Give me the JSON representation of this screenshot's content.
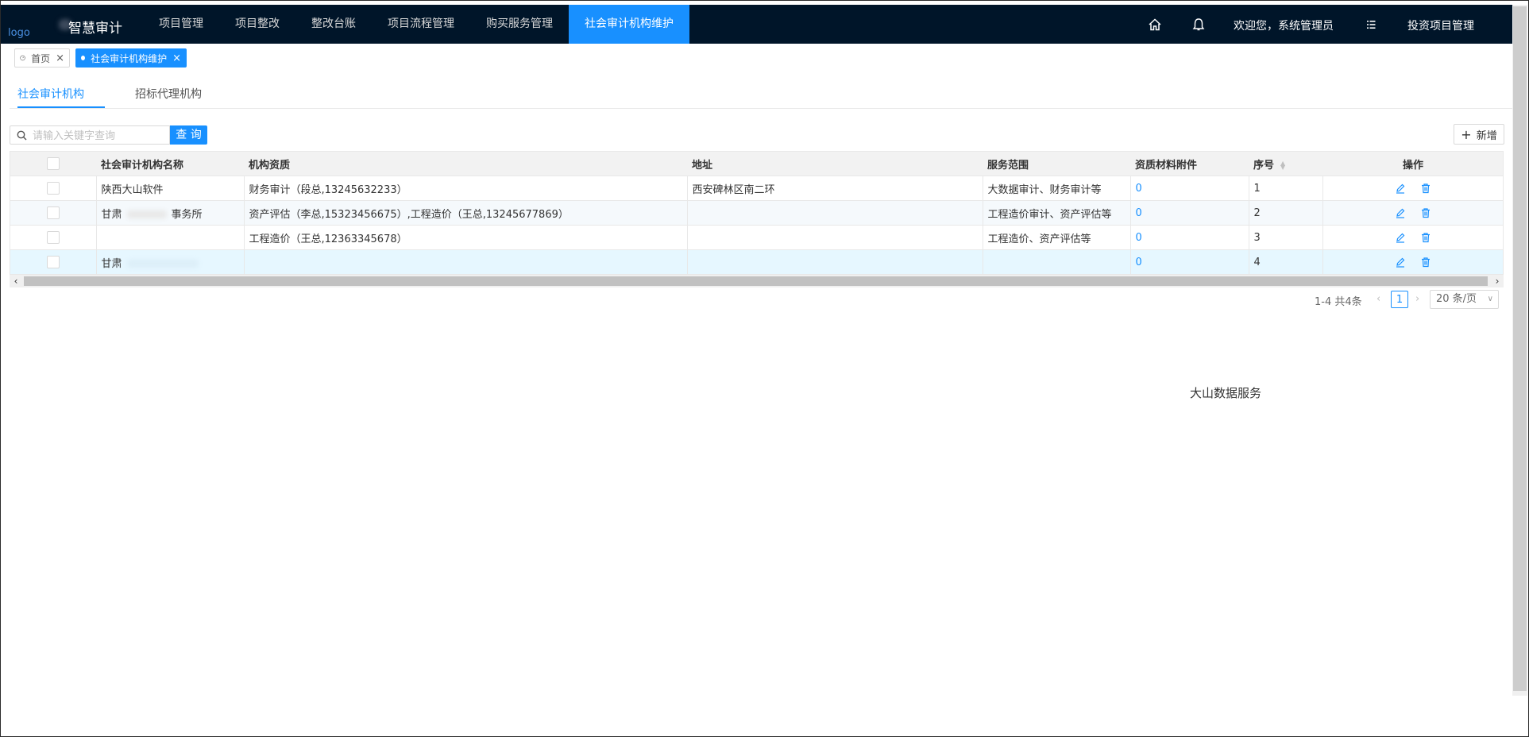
{
  "header": {
    "logo": "logo",
    "brand": "智慧审计",
    "nav": [
      "项目管理",
      "项目整改",
      "整改台账",
      "项目流程管理",
      "购买服务管理",
      "社会审计机构维护"
    ],
    "active_nav": "社会审计机构维护",
    "welcome": "欢迎您，系统管理员",
    "project_switch": "投资项目管理",
    "icons": [
      "home-icon",
      "bell-icon",
      "list-icon"
    ]
  },
  "tags": {
    "home": "首页",
    "current": "社会审计机构维护"
  },
  "subtabs": [
    "社会审计机构",
    "招标代理机构"
  ],
  "search": {
    "placeholder": "请输入关键字查询",
    "button": "查 询"
  },
  "add_button": "新增",
  "table": {
    "headers": [
      "社会审计机构名称",
      "机构资质",
      "地址",
      "服务范围",
      "资质材料附件",
      "序号",
      "操作"
    ],
    "rows": [
      {
        "name": "陕西大山软件",
        "qualification": "财务审计（段总,13245632233）",
        "address": "西安碑林区南二环",
        "scope": "大数据审计、财务审计等",
        "attachments": "0",
        "index": "1"
      },
      {
        "name": "甘肃",
        "name_suffix": "事务所",
        "qualification": "资产评估（李总,15323456675）,工程造价（王总,13245677869）",
        "address": "",
        "scope": "工程造价审计、资产评估等",
        "attachments": "0",
        "index": "2"
      },
      {
        "name": "",
        "qualification": "工程造价（王总,12363345678）",
        "address": "",
        "scope": "工程造价、资产评估等",
        "attachments": "0",
        "index": "3"
      },
      {
        "name": "甘肃",
        "qualification": "",
        "address": "",
        "scope": "",
        "attachments": "0",
        "index": "4"
      }
    ]
  },
  "pagination": {
    "total": "1-4 共4条",
    "current": "1",
    "page_size": "20 条/页"
  },
  "footer": "大山数据服务",
  "colors": {
    "header_bg": "#001529",
    "accent": "#1890ff"
  }
}
